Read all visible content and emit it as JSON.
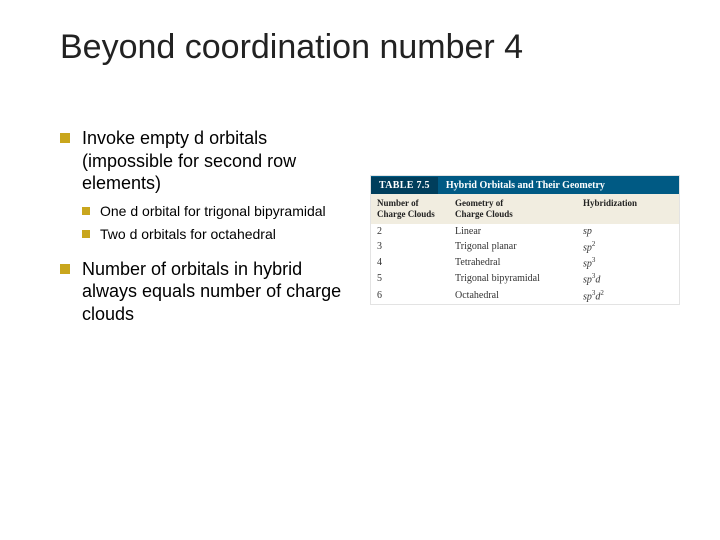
{
  "title": "Beyond coordination number 4",
  "bullets": {
    "b1": "Invoke empty d orbitals (impossible for second row elements)",
    "b1a": "One d orbital for trigonal bipyramidal",
    "b1b": "Two d orbitals for octahedral",
    "b2": "Number of orbitals in hybrid always equals number of charge clouds"
  },
  "table": {
    "label": "TABLE 7.5",
    "caption": "Hybrid Orbitals and Their Geometry",
    "headers": {
      "c1l1": "Number of",
      "c1l2": "Charge Clouds",
      "c2l1": "Geometry of",
      "c2l2": "Charge Clouds",
      "c3": "Hybridization"
    },
    "rows": [
      {
        "n": "2",
        "geom": "Linear"
      },
      {
        "n": "3",
        "geom": "Trigonal planar"
      },
      {
        "n": "4",
        "geom": "Tetrahedral"
      },
      {
        "n": "5",
        "geom": "Trigonal bipyramidal"
      },
      {
        "n": "6",
        "geom": "Octahedral"
      }
    ]
  },
  "chart_data": {
    "type": "table",
    "title": "Hybrid Orbitals and Their Geometry",
    "columns": [
      "Number of Charge Clouds",
      "Geometry of Charge Clouds",
      "Hybridization"
    ],
    "rows": [
      [
        2,
        "Linear",
        "sp"
      ],
      [
        3,
        "Trigonal planar",
        "sp2"
      ],
      [
        4,
        "Tetrahedral",
        "sp3"
      ],
      [
        5,
        "Trigonal bipyramidal",
        "sp3d"
      ],
      [
        6,
        "Octahedral",
        "sp3d2"
      ]
    ]
  }
}
